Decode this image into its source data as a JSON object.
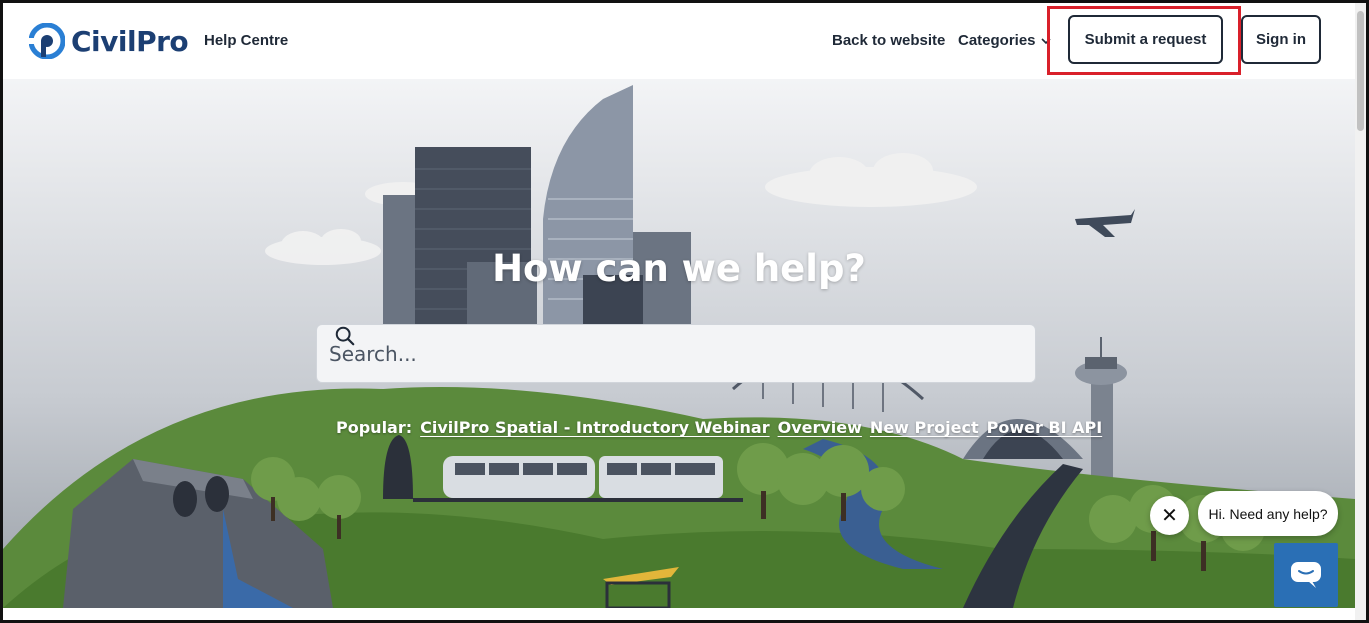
{
  "header": {
    "logo_prefix": "Civil",
    "logo_suffix": "Pro",
    "help_centre": "Help Centre",
    "nav": {
      "back_to_website": "Back to website",
      "categories": "Categories",
      "submit_request": "Submit a request",
      "sign_in": "Sign in"
    }
  },
  "hero": {
    "title": "How can we help?",
    "search_placeholder": "Search...",
    "popular_label": "Popular:",
    "popular_links": [
      "CivilPro Spatial - Introductory Webinar",
      "Overview",
      "New Project",
      "Power BI API"
    ]
  },
  "chat": {
    "greeting": "Hi. Need any help?",
    "close_symbol": "✕"
  },
  "colors": {
    "brand_blue": "#1c3f73",
    "logo_icon_blue": "#2a7fd4",
    "highlight_red": "#d9202a",
    "chat_blue": "#2a6fb5"
  },
  "icons": [
    "civilpro-logo-icon",
    "chevron-down-icon",
    "search-icon",
    "close-icon",
    "chat-icon"
  ]
}
